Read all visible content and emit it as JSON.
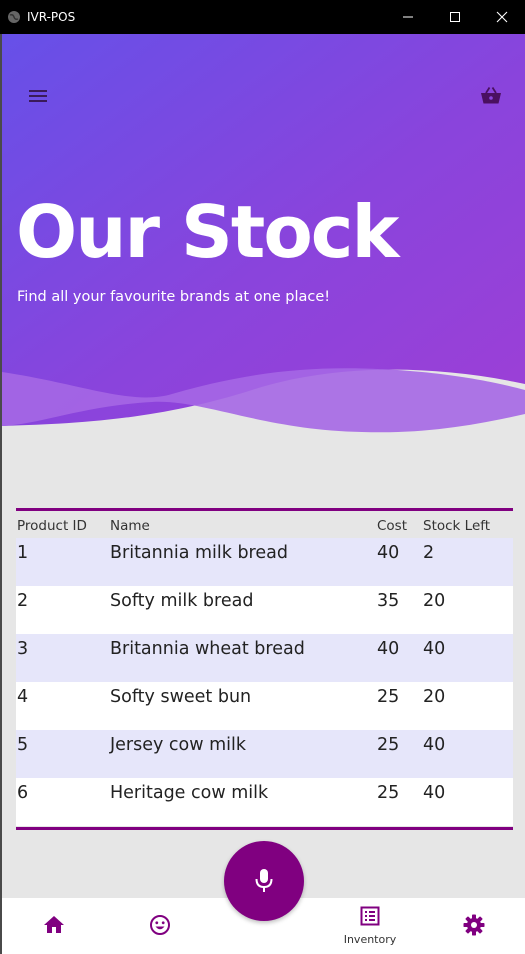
{
  "window": {
    "title": "IVR-POS"
  },
  "hero": {
    "title": "Our Stock",
    "subtitle": "Find all your favourite brands at one place!",
    "gradient_start": "#6a4fe6",
    "gradient_end": "#9a3fd6"
  },
  "table": {
    "headers": [
      "Product ID",
      "Name",
      "Cost",
      "Stock Left"
    ],
    "rows": [
      {
        "id": "1",
        "name": "Britannia milk bread",
        "cost": "40",
        "stock": "2"
      },
      {
        "id": "2",
        "name": "Softy milk bread",
        "cost": "35",
        "stock": "20"
      },
      {
        "id": "3",
        "name": "Britannia wheat bread",
        "cost": "40",
        "stock": "40"
      },
      {
        "id": "4",
        "name": "Softy sweet bun",
        "cost": "25",
        "stock": "20"
      },
      {
        "id": "5",
        "name": "Jersey cow milk",
        "cost": "25",
        "stock": "40"
      },
      {
        "id": "6",
        "name": "Heritage cow milk",
        "cost": "25",
        "stock": "40"
      }
    ],
    "accent_color": "#800080",
    "stripe_color": "#e6e6fa"
  },
  "nav": {
    "inventory_label": "Inventory",
    "icon_color": "#800080"
  }
}
